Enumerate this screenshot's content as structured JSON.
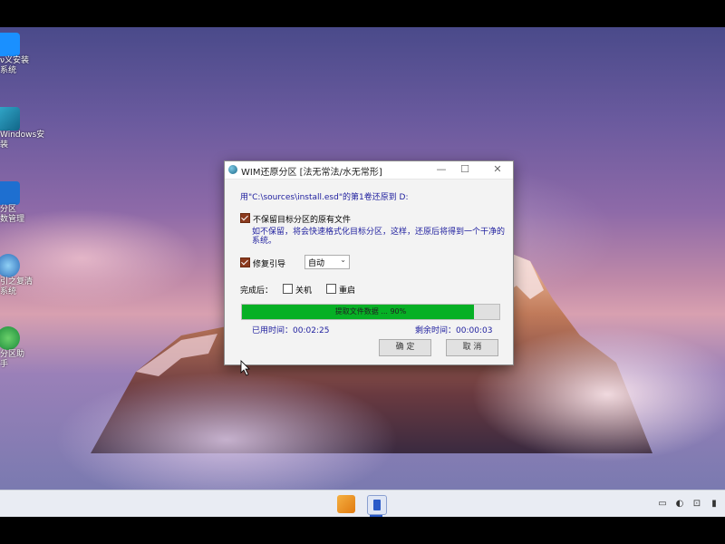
{
  "desktop_icons": [
    {
      "label_line1": "ν义安装",
      "label_line2": "系统"
    },
    {
      "label_line1": "Windows安",
      "label_line2": "装"
    },
    {
      "label_line1": "分区",
      "label_line2": "数管理"
    },
    {
      "label_line1": "引之复清",
      "label_line2": "系统"
    },
    {
      "label_line1": "分区助",
      "label_line2": "手"
    }
  ],
  "dialog": {
    "title": "WIM还原分区 [法无常法/水无常形]",
    "minimize_glyph": "—",
    "maximize_glyph": "☐",
    "close_glyph": "✕",
    "info_text": "用\"C:\\sources\\install.esd\"的第1卷还原到 D:",
    "keep_files_label": "不保留目标分区的原有文件",
    "keep_files_checked": true,
    "keep_files_desc_line1": "如不保留，将会快速格式化目标分区，这样，还原后将得到一个干净的",
    "keep_files_desc_line2": "系统。",
    "repair_boot_label": "修复引导",
    "repair_boot_checked": true,
    "repair_boot_option": "自动",
    "after_label": "完成后：",
    "shutdown_label": "关机",
    "restart_label": "重启",
    "progress_text": "提取文件数据 ... 90%",
    "progress_value": 0.9,
    "elapsed_label": "已用时间：00:02:25",
    "remaining_label": "剩余时间：00:00:03",
    "ok_label": "确 定",
    "cancel_label": "取 消"
  },
  "colors": {
    "progress": "#06b025",
    "info_text": "#1e1e9e",
    "checkbox_checked": "#8b3a1e"
  },
  "taskbar": {
    "apps": [
      "wallpaper-app-icon",
      "partition-tool-icon"
    ],
    "tray": [
      "network-icon",
      "volume-icon",
      "lock-icon",
      "battery-icon"
    ]
  }
}
